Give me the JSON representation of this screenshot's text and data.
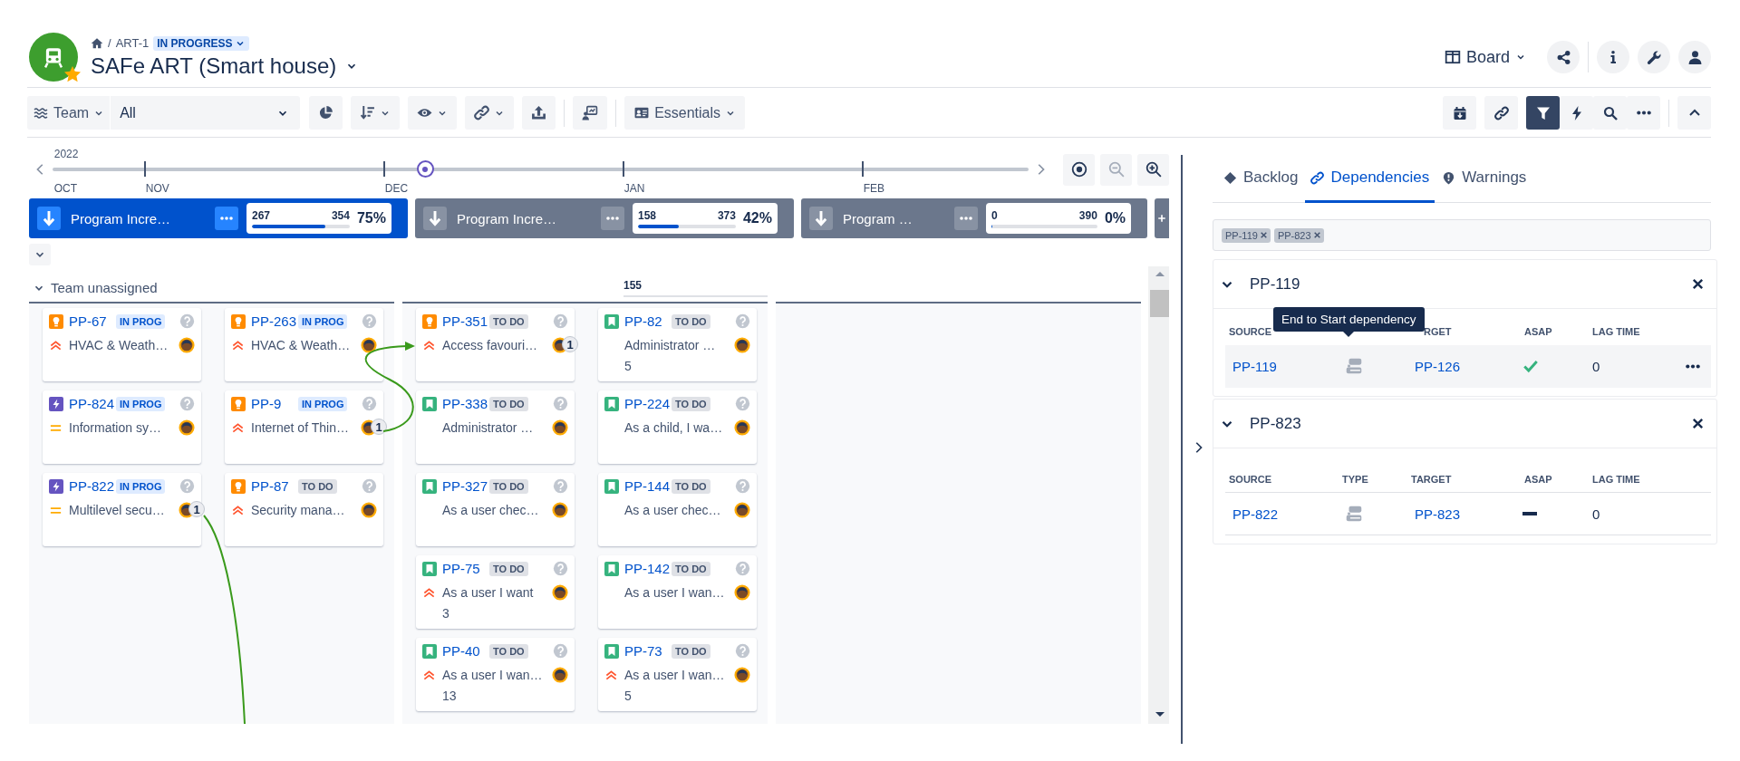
{
  "header": {
    "breadcrumb": {
      "separator": "/",
      "key": "ART-1",
      "status": "IN PROGRESS"
    },
    "title": "SAFe ART (Smart house)",
    "view": "Board"
  },
  "toolbar": {
    "group_by": "Team",
    "team_value": "All",
    "left_tools": [
      {
        "kind": "pie",
        "menu": false
      },
      {
        "kind": "sort",
        "menu": true
      },
      {
        "kind": "eye",
        "menu": true
      },
      {
        "kind": "link",
        "menu": true
      },
      {
        "kind": "upload",
        "menu": false
      }
    ],
    "fields": "Essentials",
    "right_tools": [
      {
        "kind": "calendar",
        "selected": false
      },
      {
        "kind": "link",
        "selected": false
      },
      {
        "kind": "filter",
        "selected": true
      },
      {
        "kind": "bolt",
        "selected": false
      },
      {
        "kind": "search",
        "selected": false
      },
      {
        "kind": "more",
        "selected": false
      }
    ]
  },
  "timeline": {
    "year": "2022",
    "months": [
      "OCT",
      "NOV",
      "DEC",
      "JAN",
      "FEB"
    ],
    "controls": [
      {
        "kind": "today",
        "disabled": false
      },
      {
        "kind": "zoom_out",
        "disabled": true
      },
      {
        "kind": "zoom_in",
        "disabled": false
      }
    ]
  },
  "increments": [
    {
      "name": "Program Incre…",
      "selected": true,
      "done": "267",
      "total": "354",
      "percent": "75%",
      "level": 0.75
    },
    {
      "name": "Program Incre…",
      "selected": false,
      "done": "158",
      "total": "373",
      "percent": "42%",
      "level": 0.42
    },
    {
      "name": "Program …",
      "selected": false,
      "done": "0",
      "total": "390",
      "percent": "0%",
      "level": 0
    }
  ],
  "board": {
    "groups": [
      {
        "kind": "lane",
        "title": "Team unassigned",
        "columns": [
          [
            {
              "key": "PP-67",
              "kind": "idea",
              "status": {
                "label": "IN PROG",
                "kind": "in_progress"
              },
              "priority": {
                "kind": "highest"
              },
              "summary": "HVAC & Weath…"
            },
            {
              "key": "PP-824",
              "kind": "feature",
              "status": {
                "label": "IN PROG",
                "kind": "in_progress"
              },
              "priority": {
                "kind": "medium"
              },
              "summary": "Information sy…"
            },
            {
              "key": "PP-822",
              "kind": "feature",
              "status": {
                "label": "IN PROG",
                "kind": "in_progress"
              },
              "priority": {
                "kind": "medium"
              },
              "summary": "Multilevel secu…",
              "links": "1"
            }
          ],
          [
            {
              "key": "PP-263",
              "kind": "idea",
              "status": {
                "label": "IN PROG",
                "kind": "in_progress"
              },
              "priority": {
                "kind": "highest"
              },
              "summary": "HVAC & Weath…"
            },
            {
              "key": "PP-9",
              "kind": "idea",
              "status": {
                "label": "IN PROG",
                "kind": "in_progress"
              },
              "priority": {
                "kind": "highest"
              },
              "summary": "Internet of Thin…",
              "links": "1"
            },
            {
              "key": "PP-87",
              "kind": "idea",
              "status": {
                "label": "TO DO",
                "kind": "todo"
              },
              "priority": {
                "kind": "highest"
              },
              "summary": "Security mana…"
            }
          ]
        ]
      },
      {
        "kind": "lane",
        "count": "155",
        "columns": [
          [
            {
              "key": "PP-351",
              "kind": "idea",
              "status": {
                "label": "TO DO",
                "kind": "todo"
              },
              "priority": {
                "kind": "highest"
              },
              "summary": "Access favouri…",
              "links": "1"
            },
            {
              "key": "PP-338",
              "kind": "story",
              "status": {
                "label": "TO DO",
                "kind": "todo"
              },
              "summary": "Administrator …"
            },
            {
              "key": "PP-327",
              "kind": "story",
              "status": {
                "label": "TO DO",
                "kind": "todo"
              },
              "summary": "As a user chec…"
            },
            {
              "key": "PP-75",
              "kind": "story",
              "status": {
                "label": "TO DO",
                "kind": "todo"
              },
              "priority": {
                "kind": "highest"
              },
              "summary": "As a user I want",
              "estimate": "3"
            },
            {
              "key": "PP-40",
              "kind": "story",
              "status": {
                "label": "TO DO",
                "kind": "todo"
              },
              "priority": {
                "kind": "highest"
              },
              "summary": "As a user I wan…",
              "estimate": "13"
            }
          ],
          [
            {
              "key": "PP-82",
              "kind": "story",
              "status": {
                "label": "TO DO",
                "kind": "todo"
              },
              "summary": "Administrator …",
              "estimate": "5"
            },
            {
              "key": "PP-224",
              "kind": "story",
              "status": {
                "label": "TO DO",
                "kind": "todo"
              },
              "summary": "As a child, I wa…"
            },
            {
              "key": "PP-144",
              "kind": "story",
              "status": {
                "label": "TO DO",
                "kind": "todo"
              },
              "summary": "As a user chec…"
            },
            {
              "key": "PP-142",
              "kind": "story",
              "status": {
                "label": "TO DO",
                "kind": "todo"
              },
              "summary": "As a user I wan…"
            },
            {
              "key": "PP-73",
              "kind": "story",
              "status": {
                "label": "TO DO",
                "kind": "todo"
              },
              "priority": {
                "kind": "highest"
              },
              "summary": "As a user I wan…",
              "estimate": "5"
            }
          ]
        ]
      },
      {
        "kind": "empty"
      }
    ]
  },
  "dependencies": {
    "tabs": [
      {
        "label": "Backlog",
        "kind": "backlog",
        "selected": false
      },
      {
        "label": "Dependencies",
        "kind": "dependencies",
        "selected": true
      },
      {
        "label": "Warnings",
        "kind": "warnings",
        "selected": false
      }
    ],
    "filter_chips": [
      "PP-119",
      "PP-823"
    ],
    "groups": [
      {
        "key": "PP-119",
        "expanded": true,
        "tooltip": "End to Start dependency",
        "columns": [
          {
            "label": "SOURCE"
          },
          {
            "label": "RGET",
            "partly_covered": true
          },
          {
            "label": "ASAP"
          },
          {
            "label": "LAG TIME"
          }
        ],
        "rows": [
          {
            "source": "PP-119",
            "target": "PP-126",
            "asap": true,
            "lag": "0",
            "highlighted": true
          }
        ]
      },
      {
        "key": "PP-823",
        "expanded": true,
        "columns": [
          {
            "label": "SOURCE"
          },
          {
            "label": "TYPE"
          },
          {
            "label": "TARGET"
          },
          {
            "label": "ASAP"
          },
          {
            "label": "LAG TIME"
          }
        ],
        "rows": [
          {
            "source": "PP-822",
            "target": "PP-823",
            "asap": false,
            "lag": "0",
            "highlighted": false
          }
        ]
      }
    ]
  }
}
